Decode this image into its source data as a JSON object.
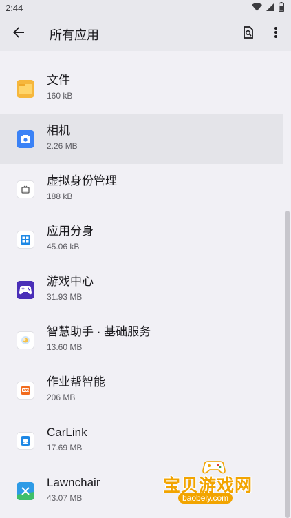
{
  "status_bar": {
    "time": "2:44",
    "icons": [
      "wifi-icon",
      "signal-icon",
      "battery-icon"
    ]
  },
  "app_bar": {
    "title": "所有应用",
    "back_icon": "arrow-back-icon",
    "search_icon": "search-document-icon",
    "more_icon": "more-vert-icon"
  },
  "apps": [
    {
      "name": "文件",
      "size": "160 kB",
      "icon": "folder-icon",
      "color": "#f6b73c"
    },
    {
      "name": "相机",
      "size": "2.26 MB",
      "icon": "camera-icon",
      "color": "#3b82f6",
      "selected": true
    },
    {
      "name": "虚拟身份管理",
      "size": "188 kB",
      "icon": "tv-icon",
      "color": "#ffffff"
    },
    {
      "name": "应用分身",
      "size": "45.06 kB",
      "icon": "apps-grid-icon",
      "color": "#1e88e5"
    },
    {
      "name": "游戏中心",
      "size": "31.93 MB",
      "icon": "gamepad-icon",
      "color": "#4a2fb8"
    },
    {
      "name": "智慧助手 · 基础服务",
      "size": "13.60 MB",
      "icon": "assistant-icon",
      "color": "#ffffff"
    },
    {
      "name": "作业帮智能",
      "size": "206 MB",
      "icon": "zuoyebang-icon",
      "color": "#ffffff"
    },
    {
      "name": "CarLink",
      "size": "17.69 MB",
      "icon": "car-icon",
      "color": "#1e88e5"
    },
    {
      "name": "Lawnchair",
      "size": "43.07 MB",
      "icon": "lawnchair-icon",
      "color": "#2e9be6"
    }
  ],
  "watermark": {
    "title": "宝贝游戏网",
    "url": "baobeiy.com"
  },
  "colors": {
    "background": "#f1f0f5",
    "app_bar": "#e8e8ed",
    "selected_row": "#e4e4e9",
    "watermark": "#f2a400"
  }
}
